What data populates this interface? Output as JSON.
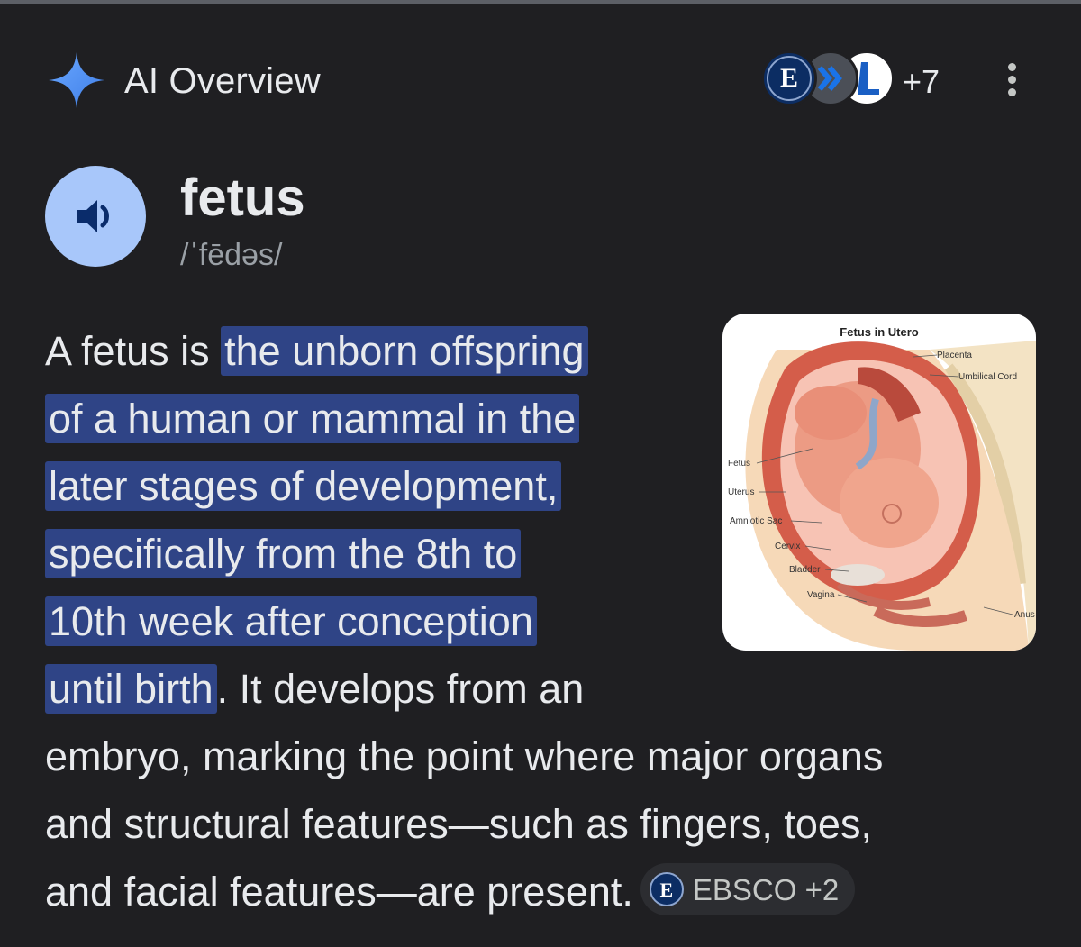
{
  "header": {
    "title": "AI Overview",
    "sources": {
      "first_letter": "E",
      "more_count": "+7"
    }
  },
  "word": {
    "term": "fetus",
    "pronunciation": "/ˈfēdəs/"
  },
  "definition": {
    "lead": "A fetus is ",
    "highlight_lines": [
      "the unborn offspring",
      "of a human or mammal in the",
      "later stages of development,",
      "specifically from the 8th to",
      "10th week after conception",
      "until birth"
    ],
    "continuation": [
      ". It develops from an",
      "embryo, marking the point where major organs",
      "and structural features—such as fingers, toes,",
      "and facial features—are present."
    ],
    "citation": {
      "letter": "E",
      "label": "EBSCO +2"
    }
  },
  "image": {
    "title": "Fetus in Utero",
    "labels": {
      "placenta": "Placenta",
      "umbilical_cord": "Umbilical Cord",
      "fetus": "Fetus",
      "uterus": "Uterus",
      "amniotic_sac": "Amniotic Sac",
      "cervix": "Cervix",
      "bladder": "Bladder",
      "vagina": "Vagina",
      "anus": "Anus"
    }
  },
  "colors": {
    "background": "#1f1f22",
    "highlight": "#2f4486",
    "speaker_button": "#a8c7fa",
    "spark": "#4c8df6"
  },
  "icons": {
    "spark": "ai-spark-icon",
    "speaker": "speaker-icon",
    "more": "more-vert-icon"
  }
}
